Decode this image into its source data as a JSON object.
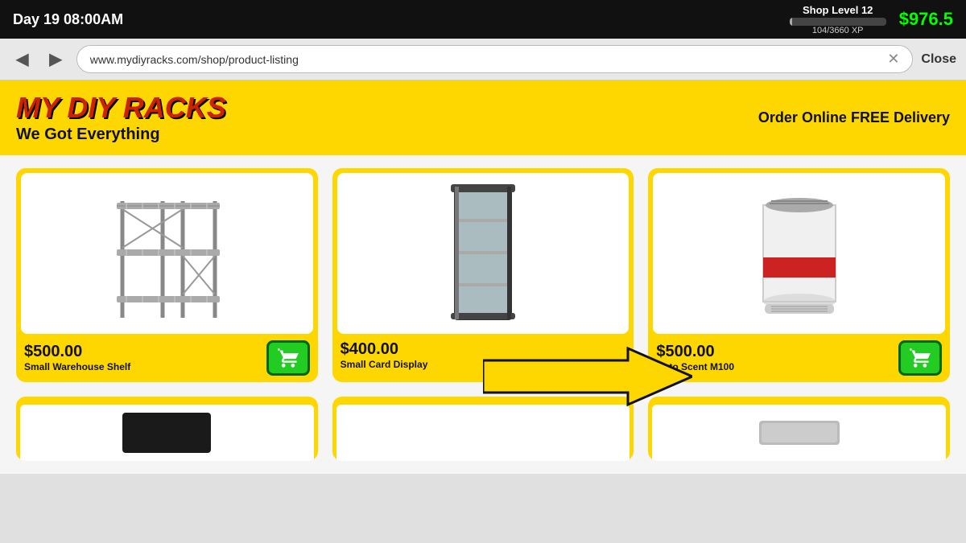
{
  "topbar": {
    "day_time": "Day 19  08:00AM",
    "shop_level": "Shop Level 12",
    "xp_current": 104,
    "xp_max": 3660,
    "xp_label": "104/3660 XP",
    "xp_percent": 3,
    "money": "$976.5"
  },
  "browser": {
    "url": "www.mydiyracks.com/shop/product-listing",
    "close_label": "Close",
    "back_icon": "◀",
    "forward_icon": "▶",
    "clear_icon": "✕"
  },
  "store": {
    "title": "MY DIY RACKS",
    "subtitle": "We Got Everything",
    "delivery_label": "Order Online FREE Delivery"
  },
  "products": [
    {
      "price": "$500.00",
      "name": "Small Warehouse Shelf",
      "has_buy": true,
      "type": "shelf"
    },
    {
      "price": "$400.00",
      "name": "Small Card Display",
      "has_buy": false,
      "type": "display_case"
    },
    {
      "price": "$500.00",
      "name": "Auto Scent M100",
      "has_buy": true,
      "type": "freshener"
    }
  ],
  "bottom_products": [
    {
      "type": "black_shelf"
    },
    {
      "type": "empty"
    },
    {
      "type": "grey_surface"
    }
  ],
  "labels": {
    "buy_button": "🛒"
  }
}
